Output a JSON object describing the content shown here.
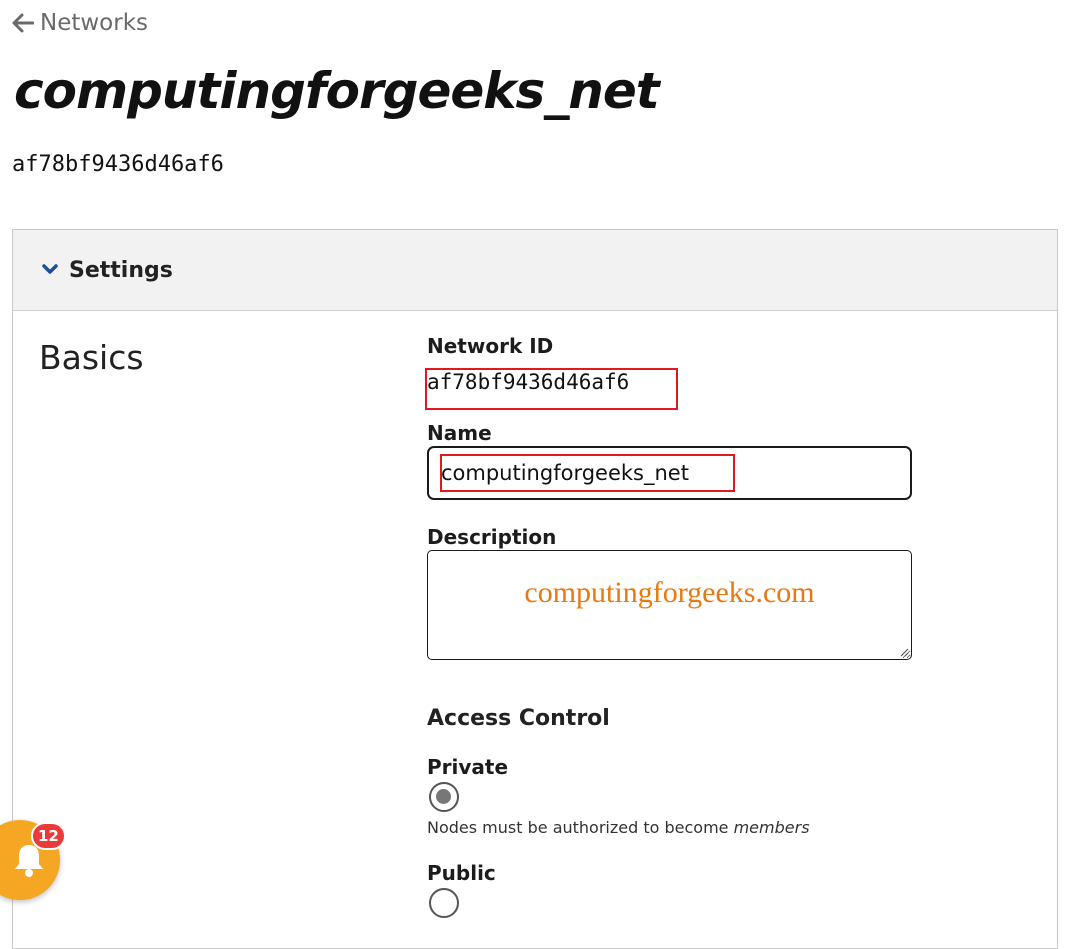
{
  "nav": {
    "back_label": "Networks"
  },
  "page": {
    "title": "computingforgeeks_net",
    "network_id_display": "af78bf9436d46af6"
  },
  "settings": {
    "header_label": "Settings",
    "section_heading": "Basics",
    "network_id_label": "Network ID",
    "network_id_value": "af78bf9436d46af6",
    "name_label": "Name",
    "name_value": "computingforgeeks_net",
    "description_label": "Description",
    "description_watermark": "computingforgeeks.com",
    "access_control_heading": "Access Control",
    "private_label": "Private",
    "private_checked": true,
    "private_help_prefix": "Nodes must be authorized to become ",
    "private_help_emphasis": "members",
    "public_label": "Public",
    "public_checked": false
  },
  "notifications": {
    "count": "12"
  },
  "colors": {
    "highlight_box": "#e0191f",
    "watermark": "#e8780f",
    "notification_button": "#f5a623",
    "notification_badge": "#ea3b3b",
    "chevron": "#1d4f91"
  },
  "icons": {
    "back": "arrow-left-icon",
    "collapse": "chevron-down-icon",
    "notifications": "bell-icon"
  }
}
